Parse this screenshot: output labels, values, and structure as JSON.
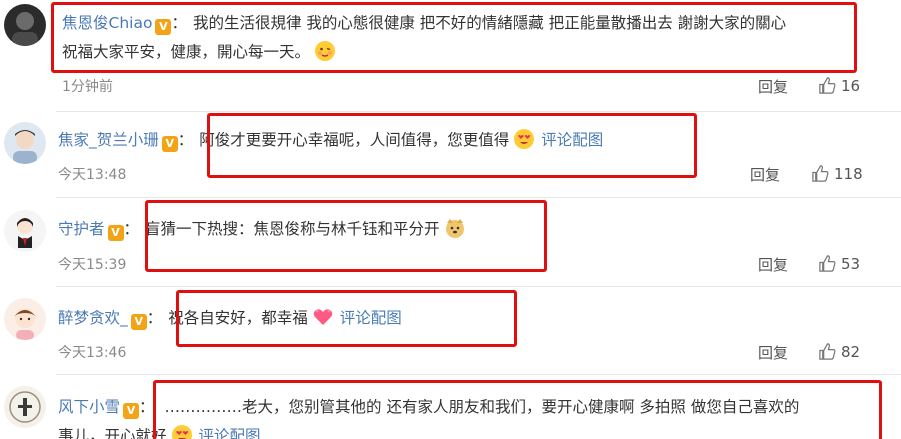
{
  "comments": [
    {
      "user": "焦恩俊Chiao",
      "badge": "V",
      "colon": "：",
      "text_line1": "我的生活很規律 我的心態很健康 把不好的情緒隱藏 把正能量散播出去 謝謝大家的關心",
      "text_line2": "祝福大家平安，健康，開心每一天。",
      "emoji": "blush-emoji-icon",
      "link": "",
      "time": "1分钟前",
      "reply": "回复",
      "likes": "16"
    },
    {
      "user": "焦家_贺兰小珊",
      "badge": "V",
      "colon": "：",
      "text_line1": "阿俊才更要开心幸福呢，人间值得，您更值得",
      "emoji": "heart-eyes-emoji-icon",
      "link": "评论配图",
      "time": "今天13:48",
      "reply": "回复",
      "likes": "118"
    },
    {
      "user": "守护者",
      "badge": "V",
      "colon": "：",
      "text_line1": "盲猜一下热搜：焦恩俊称与林千钰和平分开",
      "emoji": "doge-emoji-icon",
      "link": "",
      "time": "今天15:39",
      "reply": "回复",
      "likes": "53"
    },
    {
      "user": "醉梦贪欢_",
      "badge": "V",
      "colon": "：",
      "text_line1": "祝各自安好，都幸福",
      "emoji": "hearts-emoji-icon",
      "link": "评论配图",
      "time": "今天13:46",
      "reply": "回复",
      "likes": "82"
    },
    {
      "user": "风下小雪",
      "badge": "V",
      "colon": "：",
      "text_line1": "……………老大，您别管其他的 还有家人朋友和我们，要开心健康啊 多拍照 做您自己喜欢的",
      "text_line2": "事儿，开心就好",
      "emoji": "heart-eyes-emoji-icon",
      "link": "评论配图"
    }
  ],
  "colors": {
    "username": "#4a7ab5",
    "highlight_box": "#e01010",
    "badge": "#f2a416"
  }
}
